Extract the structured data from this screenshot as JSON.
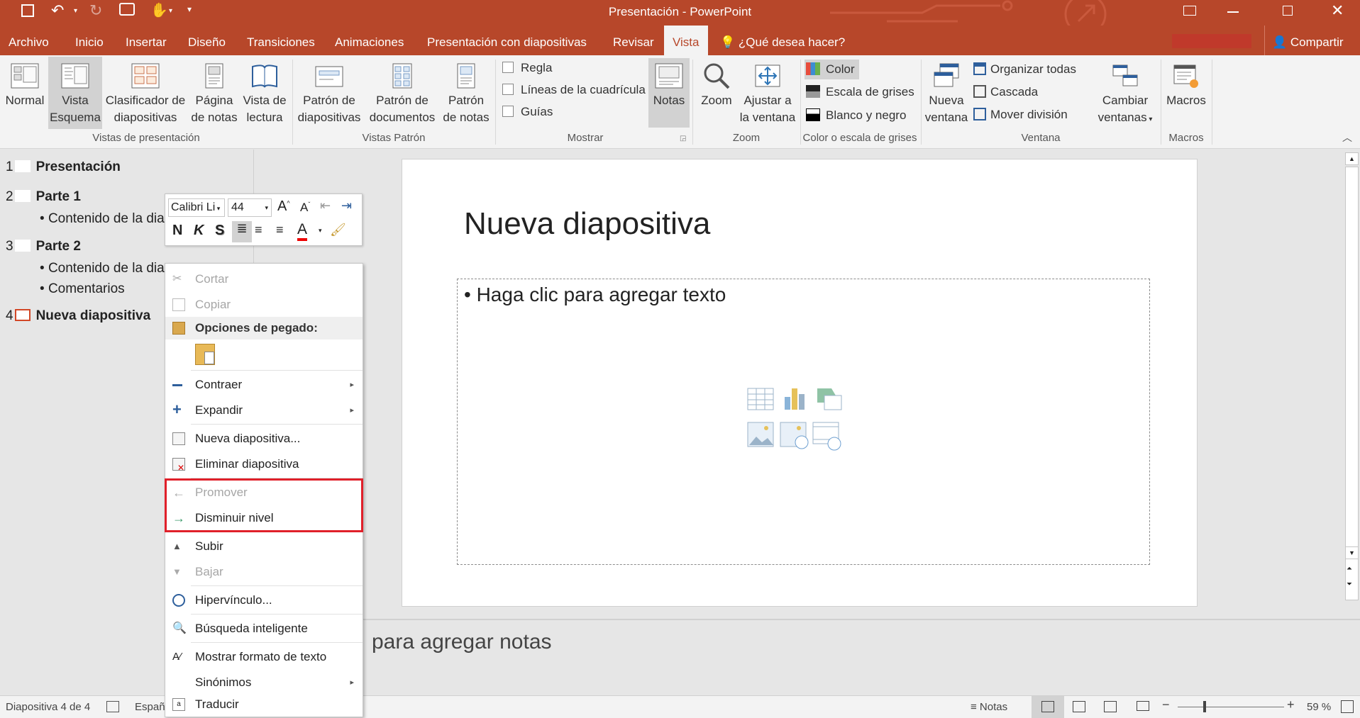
{
  "app": {
    "title": "Presentación - PowerPoint",
    "brand_color": "#b7472a"
  },
  "tabs": [
    "Archivo",
    "Inicio",
    "Insertar",
    "Diseño",
    "Transiciones",
    "Animaciones",
    "Presentación con diapositivas",
    "Revisar",
    "Vista"
  ],
  "active_tab": "Vista",
  "tell_me": "¿Qué desea hacer?",
  "share": "Compartir",
  "ribbon": {
    "vistas": {
      "group_label": "Vistas de presentación",
      "buttons": [
        {
          "l1": "Normal",
          "l2": ""
        },
        {
          "l1": "Vista",
          "l2": "Esquema"
        },
        {
          "l1": "Clasificador de",
          "l2": "diapositivas"
        },
        {
          "l1": "Página",
          "l2": "de notas"
        },
        {
          "l1": "Vista de",
          "l2": "lectura"
        }
      ]
    },
    "patron": {
      "group_label": "Vistas Patrón",
      "buttons": [
        {
          "l1": "Patrón de",
          "l2": "diapositivas"
        },
        {
          "l1": "Patrón de",
          "l2": "documentos"
        },
        {
          "l1": "Patrón",
          "l2": "de notas"
        }
      ]
    },
    "mostrar": {
      "group_label": "Mostrar",
      "checks": [
        "Regla",
        "Líneas de la cuadrícula",
        "Guías"
      ],
      "notas": "Notas"
    },
    "zoom": {
      "group_label": "Zoom",
      "zoom": "Zoom",
      "ajustar_l1": "Ajustar a",
      "ajustar_l2": "la ventana"
    },
    "color": {
      "group_label": "Color o escala de grises",
      "items": [
        "Color",
        "Escala de grises",
        "Blanco y negro"
      ]
    },
    "ventana": {
      "group_label": "Ventana",
      "nueva_l1": "Nueva",
      "nueva_l2": "ventana",
      "items": [
        "Organizar todas",
        "Cascada",
        "Mover división"
      ],
      "cambiar_l1": "Cambiar",
      "cambiar_l2": "ventanas"
    },
    "macros": {
      "group_label": "Macros",
      "label": "Macros"
    }
  },
  "outline": [
    {
      "num": "1",
      "title": "Presentación",
      "bullets": []
    },
    {
      "num": "2",
      "title": "Parte 1",
      "bullets": [
        "Contenido de la dia"
      ]
    },
    {
      "num": "3",
      "title": "Parte 2",
      "bullets": [
        "Contenido de la dia",
        "Comentarios"
      ]
    },
    {
      "num": "4",
      "title": "Nueva diapositiva",
      "bullets": []
    }
  ],
  "slide": {
    "title": "Nueva diapositiva",
    "bullet": "• Haga clic para agregar texto"
  },
  "notes_placeholder": "para agregar notas",
  "mini_toolbar": {
    "font": "Calibri Li",
    "size": "44",
    "bold": "N",
    "italic": "K",
    "shadow": "S"
  },
  "context_menu": [
    {
      "label": "Cortar",
      "disabled": true
    },
    {
      "label": "Copiar",
      "disabled": true
    },
    {
      "label": "Opciones de pegado:",
      "header": true
    },
    {
      "label": "Contraer",
      "submenu": true
    },
    {
      "label": "Expandir",
      "submenu": true
    },
    {
      "label": "Nueva diapositiva..."
    },
    {
      "label": "Eliminar diapositiva"
    },
    {
      "label": "Promover",
      "disabled": true
    },
    {
      "label": "Disminuir nivel"
    },
    {
      "label": "Subir"
    },
    {
      "label": "Bajar",
      "disabled": true
    },
    {
      "label": "Hipervínculo..."
    },
    {
      "label": "Búsqueda inteligente"
    },
    {
      "label": "Mostrar formato de texto"
    },
    {
      "label": "Sinónimos",
      "submenu": true
    },
    {
      "label": "Traducir"
    }
  ],
  "status": {
    "slide": "Diapositiva 4 de 4",
    "lang": "Españ",
    "notes": "Notas",
    "zoom": "59 %"
  }
}
